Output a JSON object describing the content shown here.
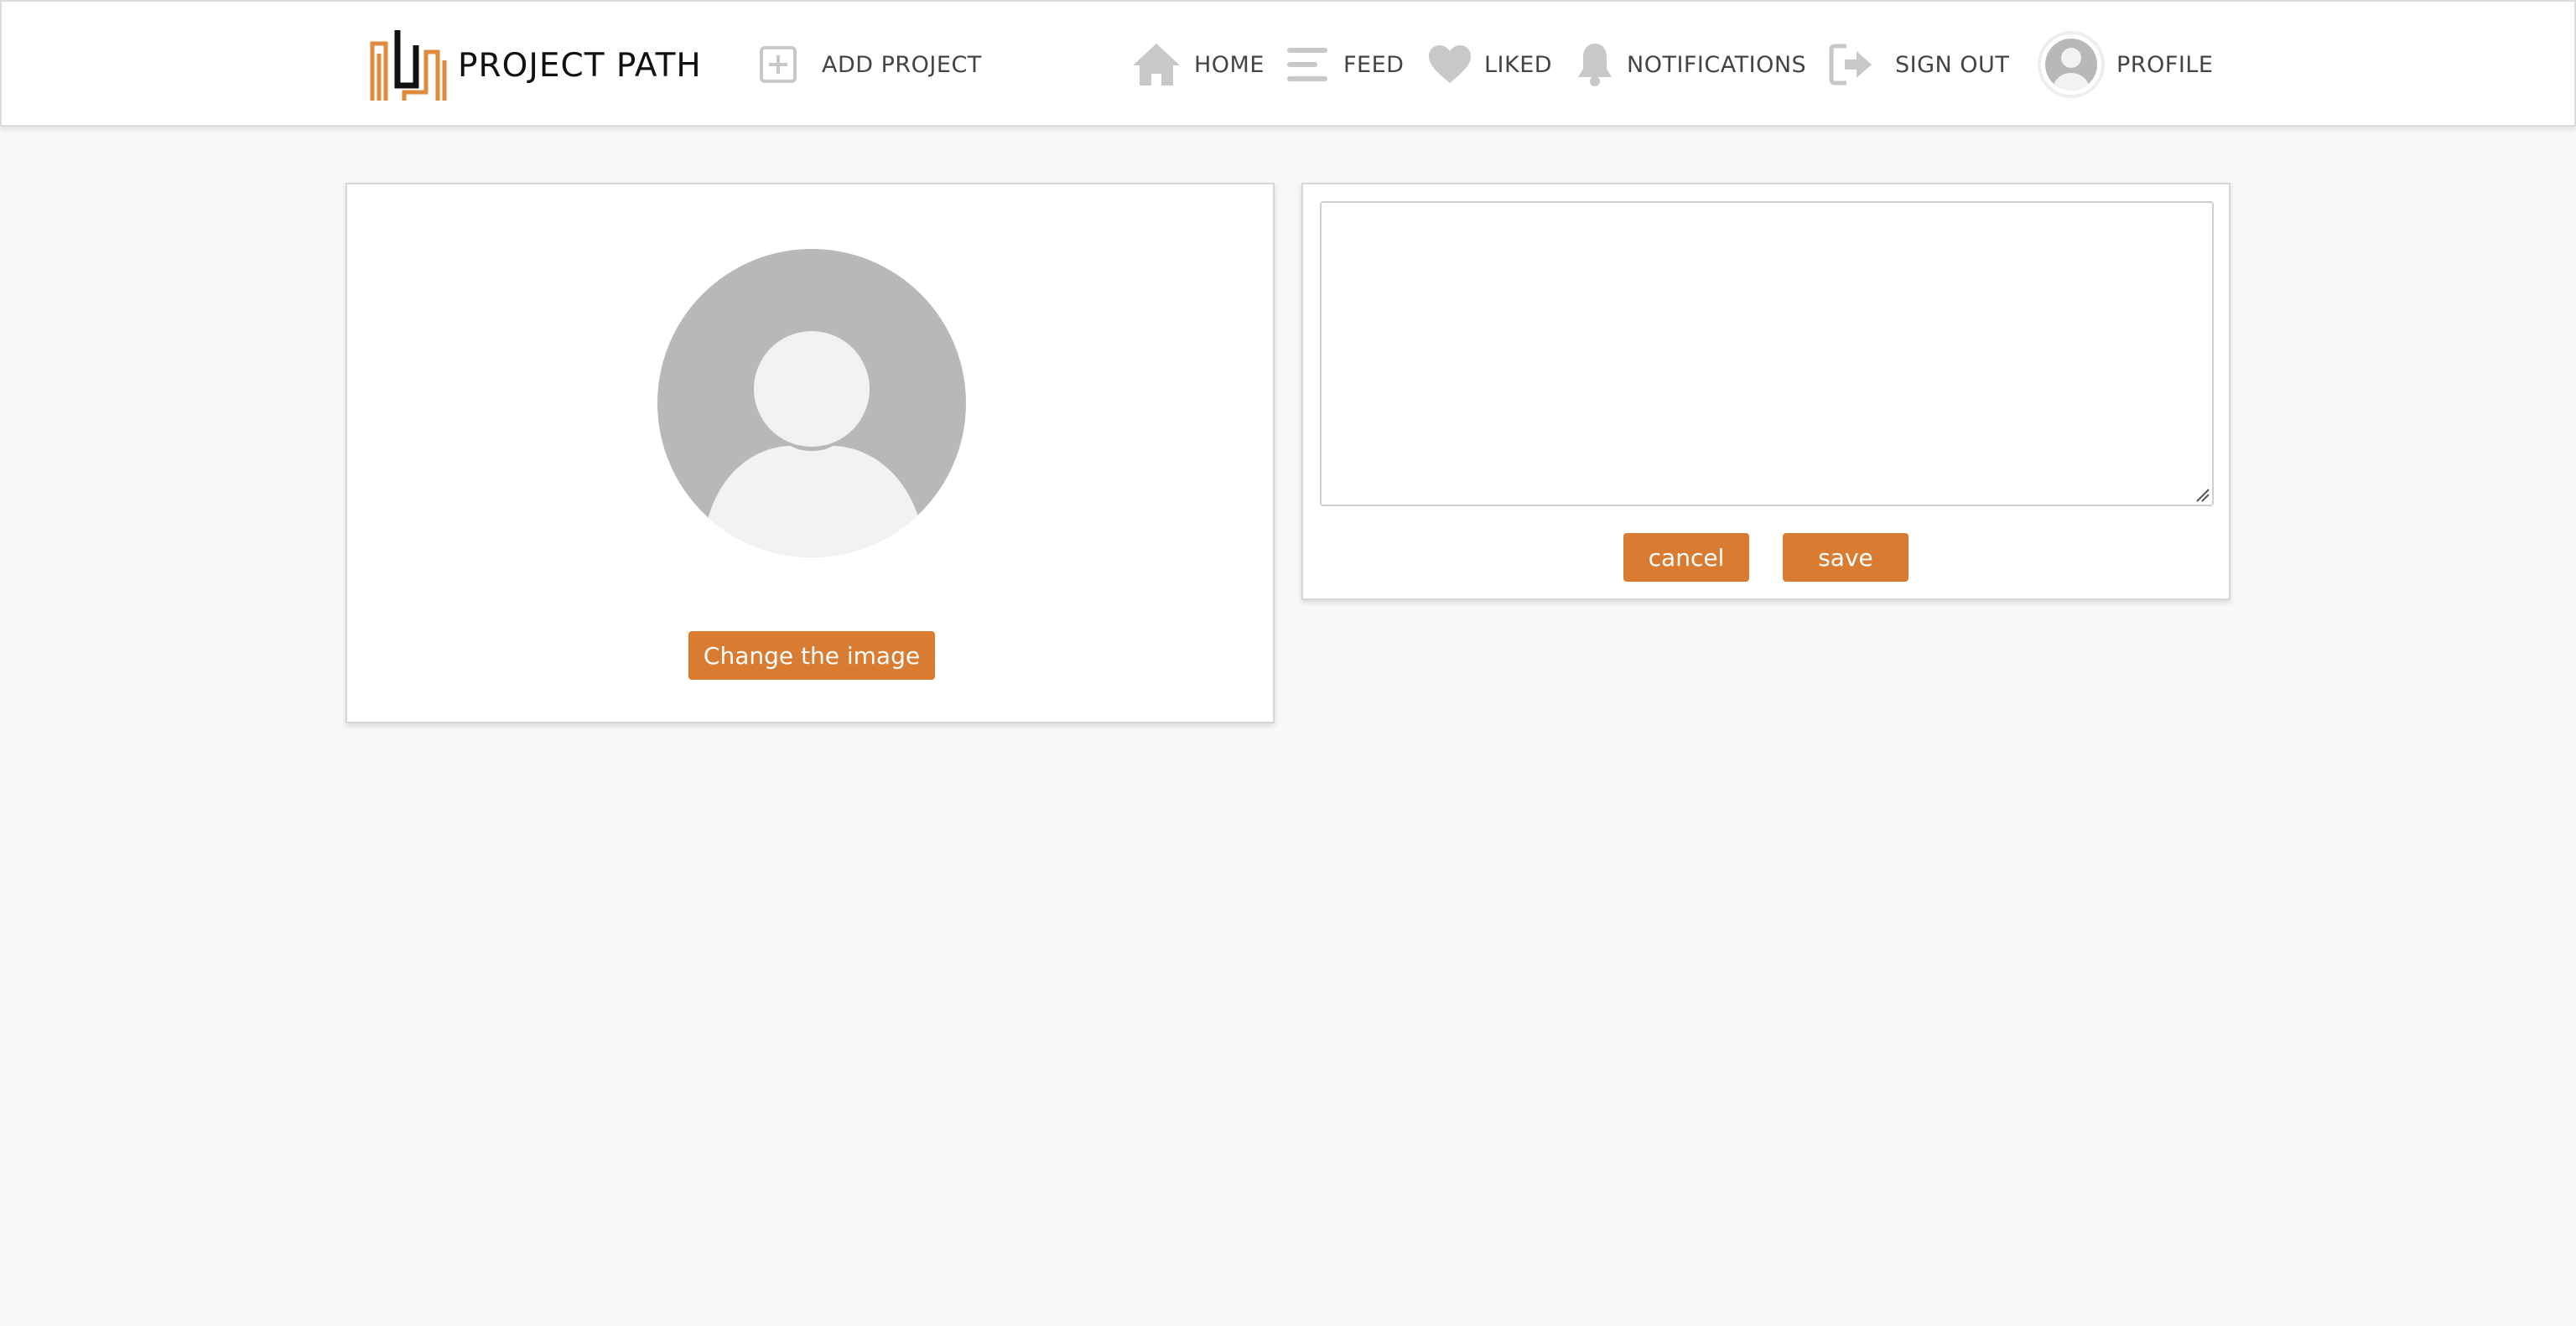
{
  "app": {
    "brand_name": "PROJECT PATH",
    "brand_logo_icon": "building-logo-icon",
    "accent_color": "#d97c31"
  },
  "nav": {
    "add_project": {
      "label": "ADD PROJECT",
      "icon": "plus-square-icon"
    },
    "home": {
      "label": "HOME",
      "icon": "home-icon"
    },
    "feed": {
      "label": "FEED",
      "icon": "menu-lines-icon"
    },
    "liked": {
      "label": "LIKED",
      "icon": "heart-icon"
    },
    "notifications": {
      "label": "NOTIFICATIONS",
      "icon": "bell-icon"
    },
    "sign_out": {
      "label": "SIGN OUT",
      "icon": "sign-out-icon"
    },
    "profile": {
      "label": "PROFILE",
      "icon": "avatar-icon"
    }
  },
  "profile_card": {
    "avatar_icon": "user-placeholder-icon",
    "change_image_label": "Change the image"
  },
  "bio_editor": {
    "value": "",
    "placeholder": "",
    "cancel_label": "cancel",
    "save_label": "save"
  }
}
